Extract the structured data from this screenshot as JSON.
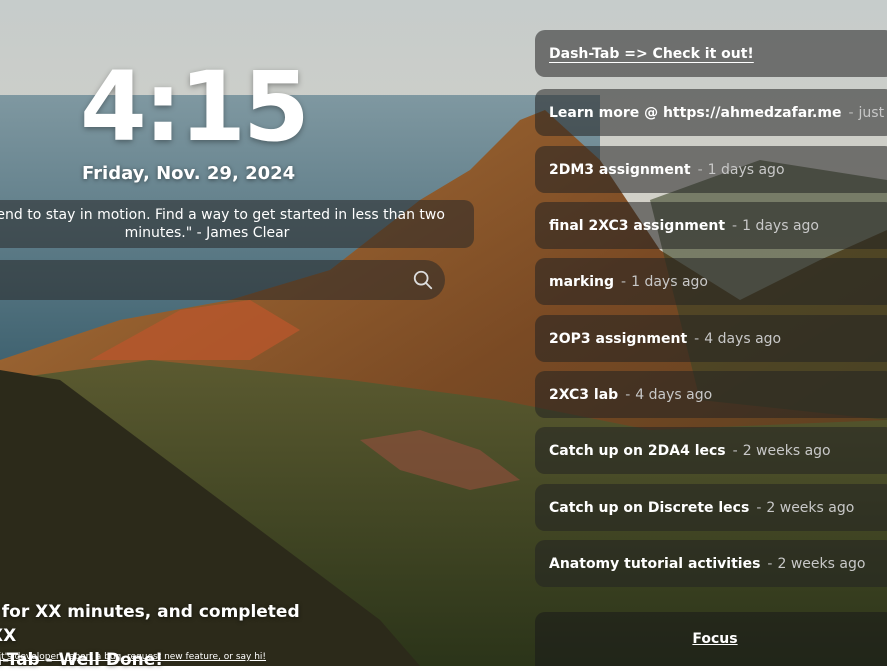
{
  "clock": {
    "time": "4:15",
    "date": "Friday, Nov. 29, 2024"
  },
  "quote": {
    "line1": "on tend to stay in motion. Find a way to get started in less than two",
    "line2": "minutes.\" - James Clear"
  },
  "search": {
    "placeholder": "",
    "icon": "search-icon"
  },
  "stats": {
    "line1": "l for XX minutes, and completed XX",
    "line2": "n-Tab - Well Done!"
  },
  "footer": {
    "link": "d it's developer, report a bug, request new feature, or say hi!"
  },
  "tasks": {
    "header": "Dash-Tab => Check it out!",
    "items": [
      {
        "name": "Learn more @ https://ahmedzafar.me",
        "time": "just now"
      },
      {
        "name": "2DM3 assignment",
        "time": "1 days ago"
      },
      {
        "name": "final 2XC3 assignment",
        "time": "1 days ago"
      },
      {
        "name": "marking",
        "time": "1 days ago"
      },
      {
        "name": "2OP3 assignment",
        "time": "4 days ago"
      },
      {
        "name": "2XC3 lab",
        "time": "4 days ago"
      },
      {
        "name": "Catch up on 2DA4 lecs",
        "time": "2 weeks ago"
      },
      {
        "name": "Catch up on Discrete lecs",
        "time": "2 weeks ago"
      },
      {
        "name": "Anatomy tutorial activities",
        "time": "2 weeks ago"
      }
    ],
    "separator": "-"
  },
  "focus": {
    "label": "Focus"
  },
  "colors": {
    "panel": "#232323",
    "sky": "#b9c4c6",
    "sea": "#5c7a86",
    "mountain": "#8a5a2c"
  }
}
